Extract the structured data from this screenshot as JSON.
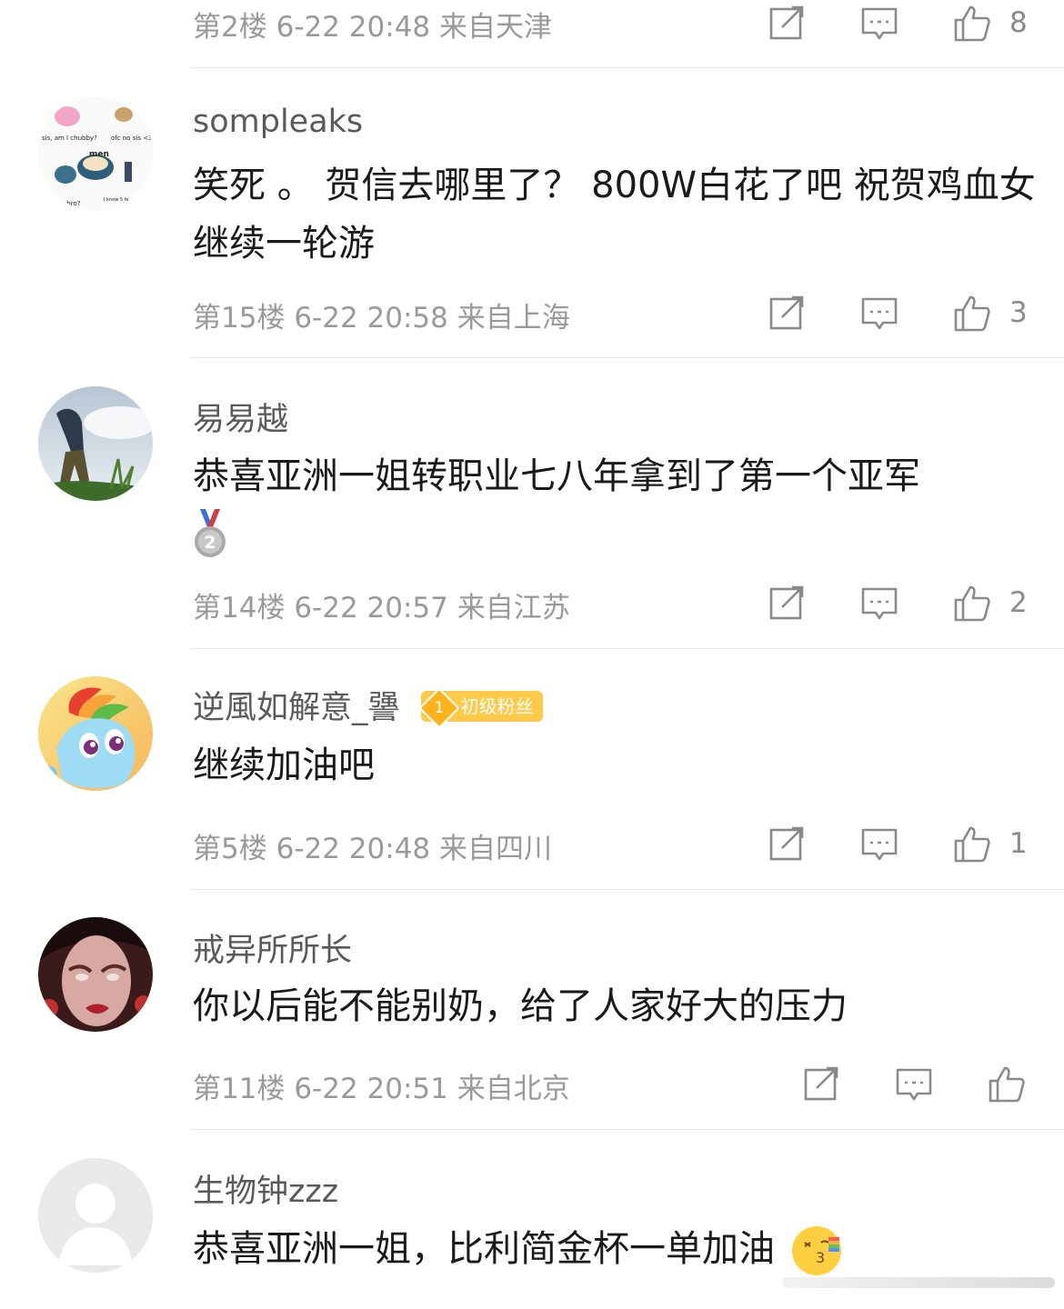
{
  "comments": [
    {
      "name": "",
      "text": "",
      "floor": "第2楼",
      "time": "6-22 20:48",
      "location": "来自天津",
      "likes": "8"
    },
    {
      "name": "sompleaks",
      "text": "笑死 。 贺信去哪里了？ 800W白花了吧 祝贺鸡血女继续一轮游",
      "floor": "第15楼",
      "time": "6-22 20:58",
      "location": "来自上海",
      "likes": "3",
      "avatar_text": [
        "sis, am I chubby?",
        "ofc no sis <3",
        "men",
        "at bro?",
        "I know 5 fe and ver"
      ]
    },
    {
      "name": "易易越",
      "text": "恭喜亚洲一姐转职业七八年拿到了第一个亚军",
      "medal": "2",
      "floor": "第14楼",
      "time": "6-22 20:57",
      "location": "来自江苏",
      "likes": "2"
    },
    {
      "name": "逆風如解意_謽",
      "badge_level": "1",
      "badge_label": "初级粉丝",
      "text": "继续加油吧",
      "floor": "第5楼",
      "time": "6-22 20:48",
      "location": "来自四川",
      "likes": "1"
    },
    {
      "name": "戒异所所长",
      "text": "你以后能不能别奶，给了人家好大的压力",
      "floor": "第11楼",
      "time": "6-22 20:51",
      "location": "来自北京",
      "likes": ""
    },
    {
      "name": "生物钟zzz",
      "text": "恭喜亚洲一姐，比利简金杯一单加油"
    }
  ],
  "icons": {
    "edit": "edit-icon",
    "reply": "reply-icon",
    "like": "thumbs-up-icon"
  },
  "colors": {
    "meta": "#9a9a9a",
    "name": "#5a5a5a",
    "text": "#1a1a1a",
    "badge": "#ffc94a"
  }
}
